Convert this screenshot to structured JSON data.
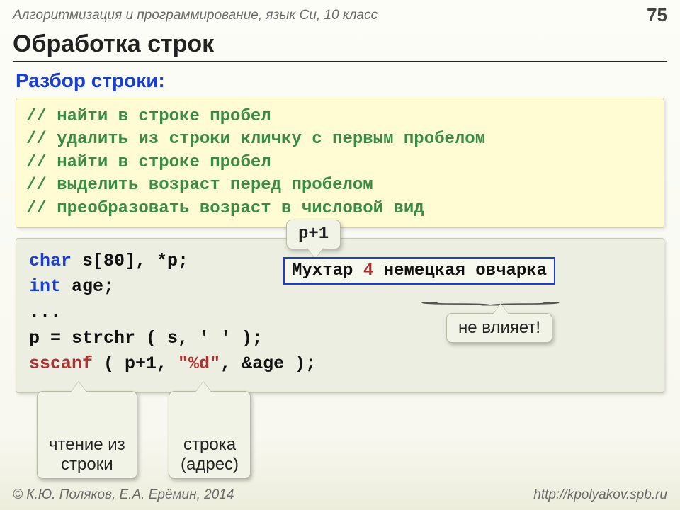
{
  "header": {
    "course": "Алгоритмизация и программирование, язык Си, 10 класс",
    "page": "75"
  },
  "title": "Обработка строк",
  "subtitle": "Разбор строки:",
  "comments": {
    "l1": "// найти в строке пробел",
    "l2": "// удалить из строки кличку с первым пробелом",
    "l3": "// найти в строке пробел",
    "l4": "// выделить возраст перед пробелом",
    "l5": "// преобразовать возраст в числовой вид"
  },
  "code": {
    "kw_char": "char",
    "decl_rest": " s[80], *p;",
    "kw_int": "int",
    "age_rest": " age;",
    "dots": "...",
    "strchr_line": "p = strchr ( s, ' ' );",
    "sscanf_pre": "sscanf",
    "sscanf_mid1": " ( p+1, ",
    "sscanf_fmt": "\"%d\"",
    "sscanf_mid2": ", &age );"
  },
  "callouts": {
    "p1": "p+1",
    "example_pre": "Мухтар ",
    "example_hl": "4",
    "example_post": " немецкая овчарка",
    "no_effect": "не влияет!",
    "read": "чтение из\nстроки",
    "addr": "строка\n(адрес)"
  },
  "footer": {
    "authors": "© К.Ю. Поляков, Е.А. Ерёмин, 2014",
    "url": "http://kpolyakov.spb.ru"
  }
}
